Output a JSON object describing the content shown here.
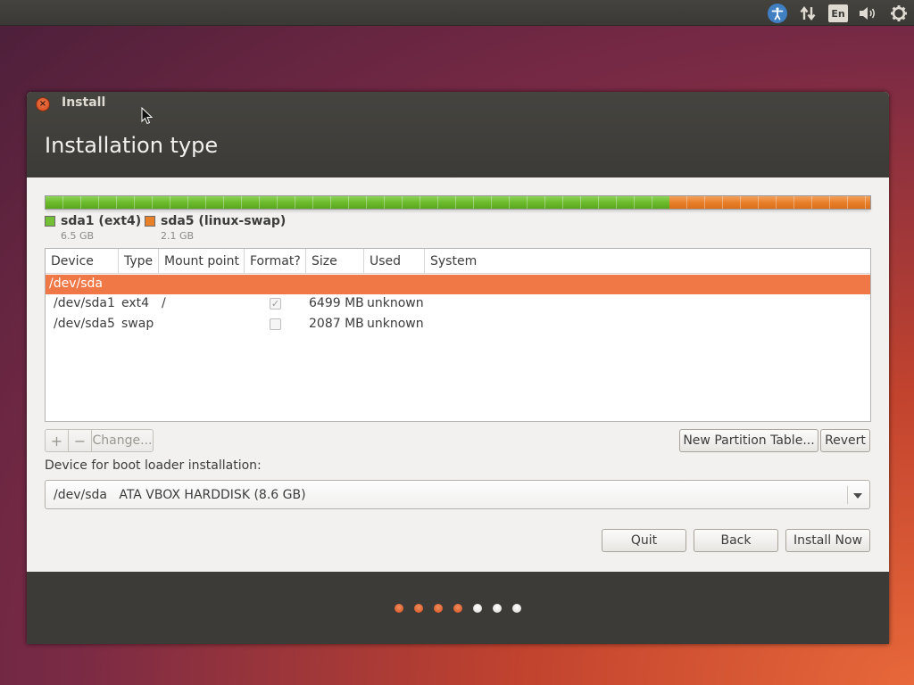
{
  "top_panel": {
    "indicators": [
      "accessibility-icon",
      "network-icon",
      "keyboard-layout",
      "sound-icon",
      "system-gear-icon"
    ],
    "keyboard_layout": "En"
  },
  "window": {
    "title": "Install",
    "page_title": "Installation type"
  },
  "partition_bar": {
    "segments": [
      {
        "name": "sda1 (ext4)",
        "size": "6.5 GB",
        "color": "#73c034",
        "fraction": 0.757
      },
      {
        "name": "sda5 (linux-swap)",
        "size": "2.1 GB",
        "color": "#e8802a",
        "fraction": 0.243
      }
    ]
  },
  "table": {
    "headers": [
      "Device",
      "Type",
      "Mount point",
      "Format?",
      "Size",
      "Used",
      "System"
    ],
    "selected_row": "/dev/sda",
    "rows": [
      {
        "device": "/dev/sda1",
        "type": "ext4",
        "mount": "/",
        "format": true,
        "size": "6499 MB",
        "used": "unknown",
        "system": ""
      },
      {
        "device": "/dev/sda5",
        "type": "swap",
        "mount": "",
        "format": false,
        "size": "2087 MB",
        "used": "unknown",
        "system": ""
      }
    ]
  },
  "toolbar": {
    "add_label": "+",
    "remove_label": "−",
    "change_label": "Change...",
    "new_partition_table_label": "New Partition Table...",
    "revert_label": "Revert"
  },
  "boot_loader": {
    "label": "Device for boot loader installation:",
    "selected": "/dev/sda   ATA VBOX HARDDISK (8.6 GB)"
  },
  "actions": {
    "quit_label": "Quit",
    "back_label": "Back",
    "install_now_label": "Install Now"
  },
  "progress": {
    "total_steps": 7,
    "completed_steps": 4,
    "done_color": "#dd5a24",
    "todo_color": "#f2f1f0"
  }
}
